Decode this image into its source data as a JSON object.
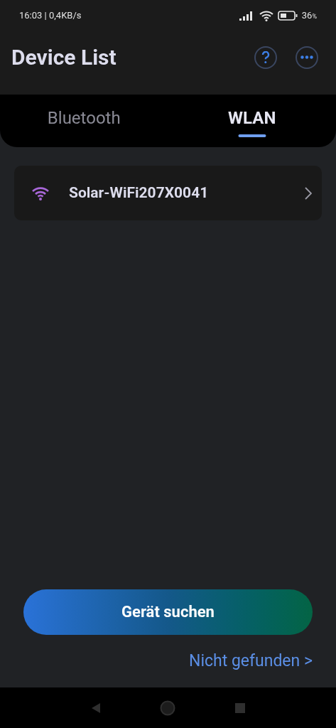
{
  "status_bar": {
    "time_speed": "16:03 | 0,4KB/s",
    "battery": "36",
    "battery_unit": "%"
  },
  "header": {
    "title": "Device List"
  },
  "tabs": [
    {
      "label": "Bluetooth",
      "selected": false
    },
    {
      "label": "WLAN",
      "selected": true
    }
  ],
  "devices": [
    {
      "name": "Solar-WiFi207X0041"
    }
  ],
  "search_button": "Gerät suchen",
  "not_found_link": "Nicht gefunden >"
}
